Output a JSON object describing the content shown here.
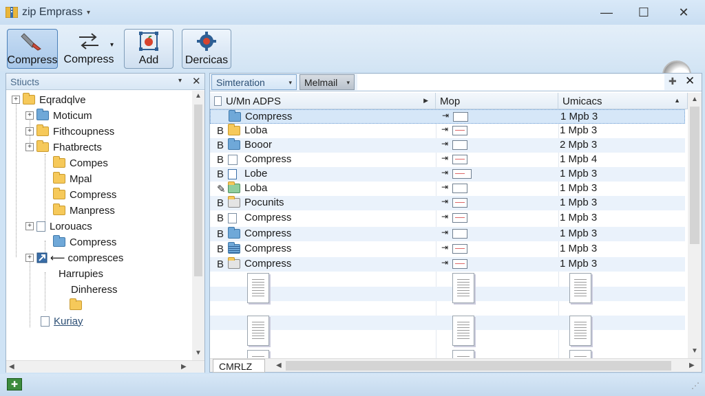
{
  "window": {
    "title": "zip Emprass",
    "title_caret": "▾",
    "minimize": "—",
    "maximize": "☐",
    "close": "✕"
  },
  "toolbar": {
    "buttons": [
      {
        "label": "Compress",
        "icon": "compress-icon"
      },
      {
        "label": "Compress",
        "icon": "arrows-icon"
      },
      {
        "label": "Add",
        "icon": "add-icon"
      },
      {
        "label": "Dercicas",
        "icon": "gear-icon"
      }
    ],
    "dropdown_glyph": "▾"
  },
  "left_pane": {
    "title": "Stiucts",
    "dropdown": "▾",
    "close": "✕",
    "tree": [
      {
        "label": "Eqradqlve",
        "expander": "+"
      },
      {
        "label": "Moticum",
        "expander": "+"
      },
      {
        "label": "Fithcoupness",
        "expander": "+"
      },
      {
        "label": "Fhatbrects",
        "expander": "+"
      },
      {
        "label": "Compes",
        "expander": ""
      },
      {
        "label": "Mpal",
        "expander": ""
      },
      {
        "label": "Compress",
        "expander": ""
      },
      {
        "label": "Manpress",
        "expander": ""
      },
      {
        "label": "Lorouacs",
        "expander": "+"
      },
      {
        "label": "Compress",
        "expander": ""
      },
      {
        "label": "compresces",
        "expander": "+"
      },
      {
        "label": "Harrupies",
        "expander": ""
      },
      {
        "label": "Dinheress",
        "expander": ""
      },
      {
        "label": "",
        "expander": ""
      },
      {
        "label": "Kuriay",
        "expander": ""
      }
    ]
  },
  "right_pane": {
    "filter": "Simteration",
    "view": "Melmail",
    "filter_arrow": "▾",
    "pin": "✚",
    "close": "✕",
    "columns": [
      {
        "label": "U/Mn ADPS"
      },
      {
        "label": "Mop"
      },
      {
        "label": "Umicacs"
      }
    ],
    "sort_glyph": "▶",
    "sort_glyph2": "▲",
    "rows": [
      {
        "b": "",
        "name": "Compress",
        "umi": "1 Mpb 3"
      },
      {
        "b": "B",
        "name": "Loba",
        "umi": "1 Mpb 3"
      },
      {
        "b": "B",
        "name": "Booor",
        "umi": "2 Mpb 3"
      },
      {
        "b": "B",
        "name": "Compress",
        "umi": "1 Mpb 4"
      },
      {
        "b": "B",
        "name": "Lobe",
        "umi": "1 Mpb 3"
      },
      {
        "b": "",
        "name": "Loba",
        "umi": "1 Mpb 3"
      },
      {
        "b": "B",
        "name": "Pocunits",
        "umi": "1 Mpb 3"
      },
      {
        "b": "B",
        "name": "Compress",
        "umi": "1 Mpb 3"
      },
      {
        "b": "B",
        "name": "Compress",
        "umi": "1 Mpb 3"
      },
      {
        "b": "B",
        "name": "Compress",
        "umi": "1 Mpb 3"
      },
      {
        "b": "B",
        "name": "Compress",
        "umi": "1 Mpb 3"
      }
    ],
    "mop_arrow": "⇥",
    "bottom_tab": "CMRLZ"
  },
  "colors": {
    "accent": "#4a7fb8",
    "folder": "#f6c95a",
    "folder_blue": "#6fa8d8"
  }
}
